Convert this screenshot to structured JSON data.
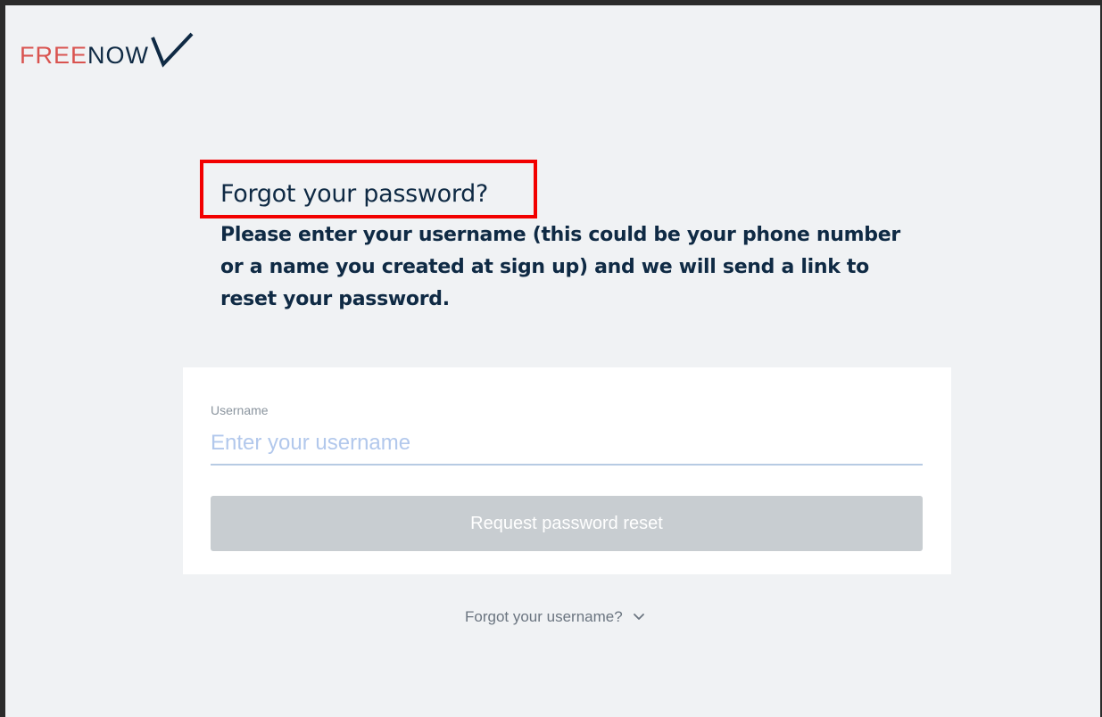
{
  "logo": {
    "part1": "FREE",
    "part2": "NOW",
    "icon": "checkmark-logo-icon"
  },
  "page": {
    "title": "Forgot your password?",
    "description": "Please enter your username (this could be your phone number or a name you created at sign up) and we will send a link to reset your password."
  },
  "form": {
    "username_label": "Username",
    "username_placeholder": "Enter your username",
    "username_value": "",
    "submit_label": "Request password reset"
  },
  "links": {
    "forgot_username": "Forgot your username?",
    "forgot_username_icon": "chevron-down-icon"
  },
  "colors": {
    "background": "#f0f2f4",
    "brand_red": "#d9534f",
    "brand_navy": "#0f2a44",
    "highlight_red": "#f20000",
    "button_disabled": "#c8cdd1",
    "input_underline": "#b7cbe3"
  }
}
